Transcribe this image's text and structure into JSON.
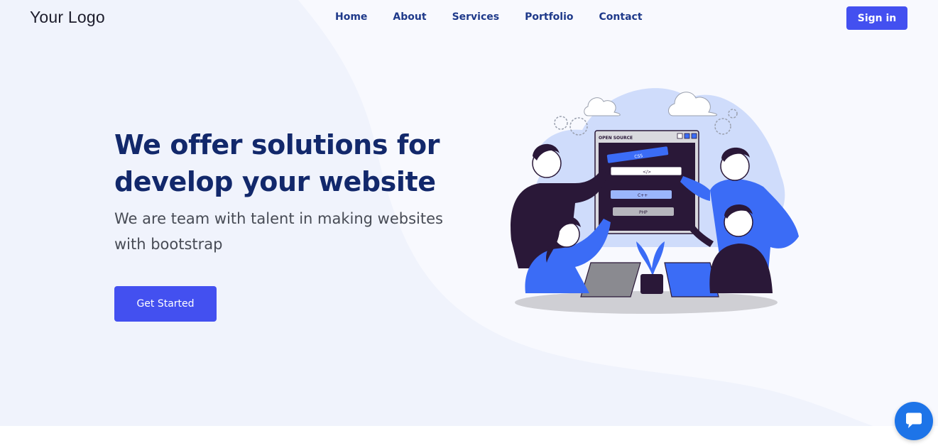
{
  "header": {
    "logo": "Your Logo",
    "nav": [
      "Home",
      "About",
      "Services",
      "Portfolio",
      "Contact"
    ],
    "signin_label": "Sign in"
  },
  "hero": {
    "headline_line1": "We offer solutions for",
    "headline_line2": "develop your website",
    "subline_line1": "We are team with talent in making websites",
    "subline_line2": "with bootstrap",
    "cta_label": "Get Started"
  },
  "illustration": {
    "screen_title": "OPEN SOURCE",
    "tags": [
      "CSS",
      "</>",
      "C++",
      "PHP"
    ]
  },
  "icons": {
    "chat": "chat-bubble-icon"
  },
  "colors": {
    "primary": "#4350f0",
    "heading": "#12286b",
    "nav_text": "#1f3a8a",
    "hero_bg": "#f0f3fc",
    "chat": "#1d74e8",
    "illustration_blue": "#3b6cf6",
    "illustration_dark": "#2a1838"
  }
}
